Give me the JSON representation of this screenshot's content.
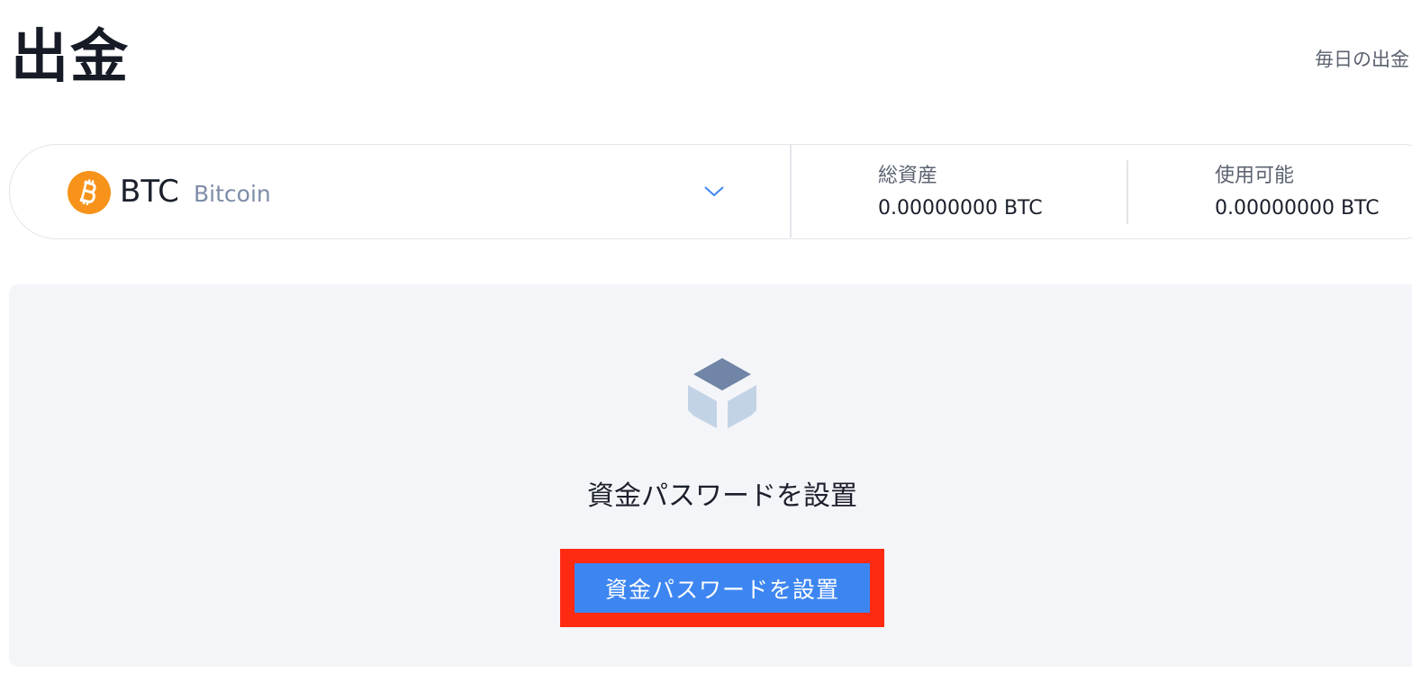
{
  "header": {
    "title": "出金",
    "daily_limit_link": "毎日の出金"
  },
  "currency": {
    "symbol": "BTC",
    "name": "Bitcoin",
    "icon": "bitcoin-icon",
    "icon_color": "#f7931a"
  },
  "balances": {
    "total_label": "総資産",
    "total_value": "0.00000000 BTC",
    "available_label": "使用可能",
    "available_value": "0.00000000 BTC"
  },
  "empty_state": {
    "icon": "box-icon",
    "message": "資金パスワードを設置",
    "button_label": "資金パスワードを設置",
    "button_color": "#3d86f1",
    "highlight_color": "#ff2a12"
  }
}
